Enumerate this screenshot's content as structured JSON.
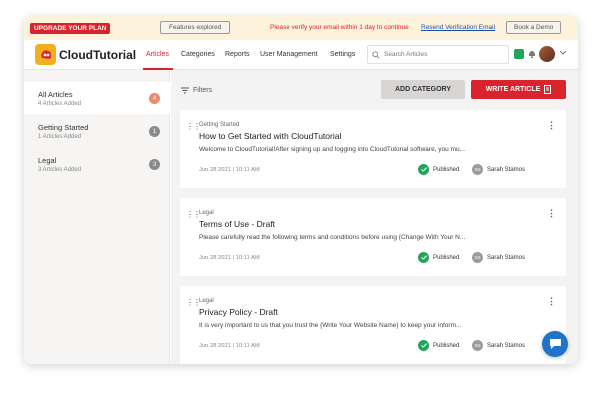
{
  "banner": {
    "upgrade_label": "UPGRADE YOUR PLAN",
    "features_label": "Features explored",
    "verify_text": "Please verify your email within 1 day to continue",
    "resend_label": "Resend Verification Email",
    "demo_label": "Book a Demo"
  },
  "brand": {
    "name": "CloudTutorial",
    "accent": "#d9232d",
    "logo_color": "#f2b01e"
  },
  "nav": {
    "items": [
      {
        "label": "Articles",
        "active": true
      },
      {
        "label": "Categories"
      },
      {
        "label": "Reports"
      },
      {
        "label": "User Management"
      },
      {
        "label": "Settings"
      }
    ],
    "search_placeholder": "Search Articles"
  },
  "sidebar": {
    "items": [
      {
        "label": "All Articles",
        "sub": "4 Articles Added",
        "count": "4",
        "count_color": "#f0876f",
        "active": true
      },
      {
        "label": "Getting Started",
        "sub": "1 Articles Added",
        "count": "1",
        "count_color": "#8a8a8a"
      },
      {
        "label": "Legal",
        "sub": "3 Articles Added",
        "count": "3",
        "count_color": "#8a8a8a"
      }
    ]
  },
  "toolbar": {
    "filters_label": "Filters",
    "add_category_label": "ADD CATEGORY",
    "write_article_label": "WRITE ARTICLE"
  },
  "articles": [
    {
      "category": "Getting Started",
      "title": "How to Get Started with CloudTutorial",
      "excerpt": "Welcome to CloudTutorial!After signing up and logging into CloudTutorial software, you mu...",
      "date": "Jun 28 2021 | 10:11 AM",
      "status": "Published",
      "author": "Sarah Stamos",
      "author_initials": "SS"
    },
    {
      "category": "Legal",
      "title": "Terms of Use - Draft",
      "excerpt": "Please carefully read the following terms and conditions before using {Change With Your N...",
      "date": "Jun 28 2021 | 10:11 AM",
      "status": "Published",
      "author": "Sarah Stamos",
      "author_initials": "SS"
    },
    {
      "category": "Legal",
      "title": "Privacy Policy - Draft",
      "excerpt": "It is very important to us that you trust the {Write Your Website Name} to keep your inform...",
      "date": "Jun 28 2021 | 10:11 AM",
      "status": "Published",
      "author": "Sarah Stamos",
      "author_initials": "SS"
    }
  ]
}
